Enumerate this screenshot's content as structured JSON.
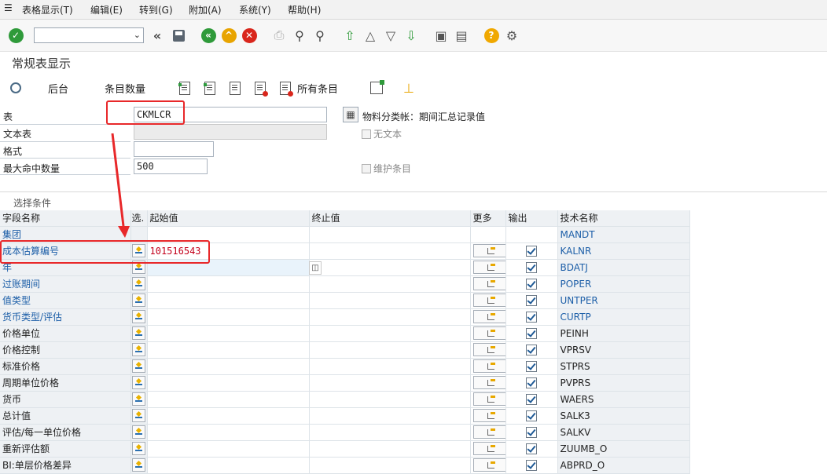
{
  "menu": [
    "表格显示(T)",
    "编辑(E)",
    "转到(G)",
    "附加(A)",
    "系统(Y)",
    "帮助(H)"
  ],
  "page_title": "常规表显示",
  "app_toolbar": {
    "back": "后台",
    "entries_count": "条目数量",
    "all_entries": "所有条目"
  },
  "form": {
    "table_label": "表",
    "table_value": "CKMLCR",
    "table_desc": "物料分类帐：期间汇总记录值",
    "text_table_label": "文本表",
    "no_text_label": "无文本",
    "format_label": "格式",
    "max_hits_label": "最大命中数量",
    "max_hits_value": "500",
    "maintain_label": "维护条目"
  },
  "selection": {
    "header": "选择条件",
    "columns": {
      "field": "字段名称",
      "sel": "选.",
      "from": "起始值",
      "to": "终止值",
      "more": "更多",
      "output": "输出",
      "tech": "技术名称"
    },
    "rows": [
      {
        "field": "集团",
        "tech": "MANDT",
        "from": "",
        "key": true,
        "has_controls": false
      },
      {
        "field": "成本估算编号",
        "tech": "KALNR",
        "from": "101516543",
        "key": true,
        "has_controls": true
      },
      {
        "field": "年",
        "tech": "BDATJ",
        "from": "",
        "key": true,
        "has_controls": true
      },
      {
        "field": "过账期间",
        "tech": "POPER",
        "from": "",
        "key": true,
        "has_controls": true
      },
      {
        "field": "值类型",
        "tech": "UNTPER",
        "from": "",
        "key": true,
        "has_controls": true
      },
      {
        "field": "货币类型/评估",
        "tech": "CURTP",
        "from": "",
        "key": true,
        "has_controls": true
      },
      {
        "field": "价格单位",
        "tech": "PEINH",
        "from": "",
        "key": false,
        "has_controls": true
      },
      {
        "field": "价格控制",
        "tech": "VPRSV",
        "from": "",
        "key": false,
        "has_controls": true
      },
      {
        "field": "标准价格",
        "tech": "STPRS",
        "from": "",
        "key": false,
        "has_controls": true
      },
      {
        "field": "周期单位价格",
        "tech": "PVPRS",
        "from": "",
        "key": false,
        "has_controls": true
      },
      {
        "field": "货币",
        "tech": "WAERS",
        "from": "",
        "key": false,
        "has_controls": true
      },
      {
        "field": "总计值",
        "tech": "SALK3",
        "from": "",
        "key": false,
        "has_controls": true
      },
      {
        "field": "评估/每一单位价格",
        "tech": "SALKV",
        "from": "",
        "key": false,
        "has_controls": true
      },
      {
        "field": "重新评估额",
        "tech": "ZUUMB_O",
        "from": "",
        "key": false,
        "has_controls": true
      },
      {
        "field": "BI:单层价格差异",
        "tech": "ABPRD_O",
        "from": "",
        "key": false,
        "has_controls": true
      }
    ]
  },
  "colors": {
    "key_field": "#1d5fa8",
    "highlight": "#e8282a",
    "value_red": "#c3001b"
  }
}
